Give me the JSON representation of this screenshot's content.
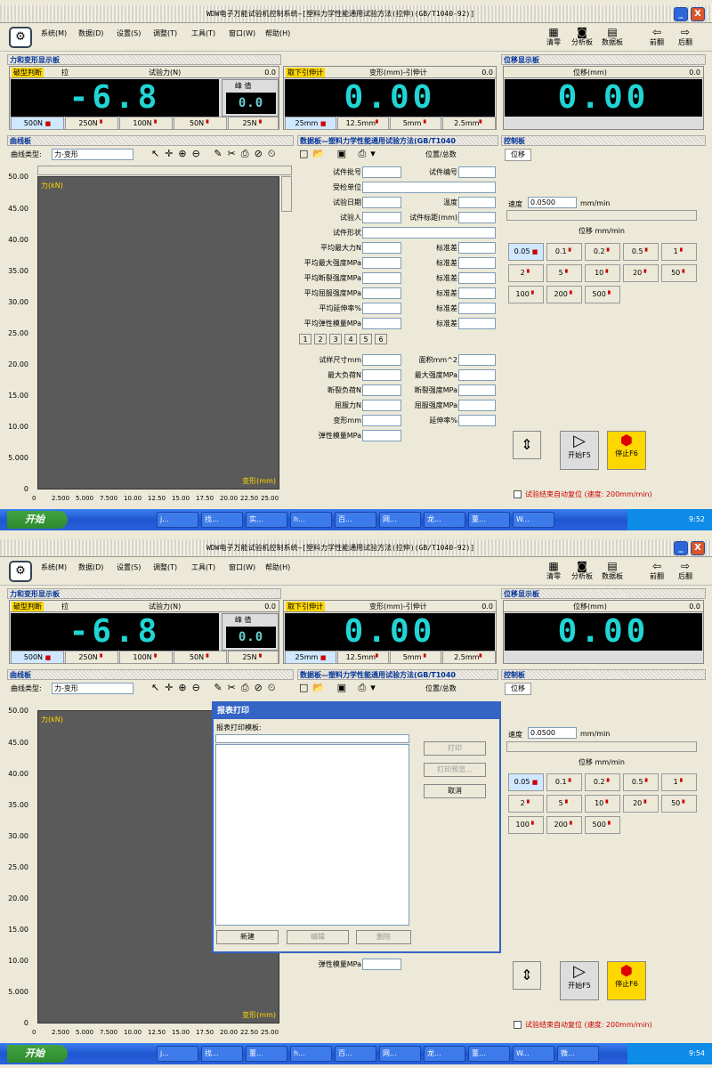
{
  "window": {
    "title": "WDW电子万能试验机控制系统—[塑料力学性能通用试验方法(拉伸)(GB/T1040-92)]",
    "minimize": "_",
    "close": "X"
  },
  "menu": [
    "系统(M)",
    "数据(D)",
    "设置(S)",
    "调整(T)",
    "工具(T)",
    "窗口(W)",
    "帮助(H)"
  ],
  "toolbar": {
    "clear": "清零",
    "analysis": "分析板",
    "data": "数据板",
    "prev": "前翻",
    "next": "后翻"
  },
  "panels": {
    "force_title": "力和变形显示板",
    "disp_title": "位移显示板",
    "curve_title": "曲线板",
    "data_title": "数据板—塑料力学性能通用试验方法(GB/T1040",
    "control_title": "控制板"
  },
  "force": {
    "mode": "破型判断",
    "tension": "拉",
    "label": "试验力(N)",
    "small_val": "0.0",
    "value": "-6.8",
    "peak_label": "峰 值",
    "peak_value": "0.0",
    "ranges": [
      "500N",
      "250N",
      "100N",
      "50N",
      "25N"
    ]
  },
  "deform": {
    "mode": "取下引伸计",
    "label": "变形(mm)-引伸计",
    "small_val": "0.0",
    "value": "0.00",
    "ranges": [
      "25mm",
      "12.5mm",
      "5mm",
      "2.5mm"
    ]
  },
  "disp": {
    "label": "位移(mm)",
    "small_val": "0.0",
    "value": "0.00"
  },
  "curve": {
    "type_label": "曲线类型:",
    "type_value": "力-变形",
    "yaxis": "力(kN)",
    "xaxis": "变形(mm)",
    "yticks": [
      "50.00",
      "45.00",
      "40.00",
      "35.00",
      "30.00",
      "25.00",
      "20.00",
      "15.00",
      "10.00",
      "5.000",
      "0"
    ],
    "xticks": [
      "0",
      "2.500",
      "5.000",
      "7.500",
      "10.00",
      "12.50",
      "15.00",
      "17.50",
      "20.00",
      "22.50",
      "25.00"
    ]
  },
  "datapanel": {
    "nav": "位置/总数",
    "fields": [
      {
        "l": "试件批号",
        "r": "试件编号"
      },
      {
        "l": "受检单位",
        "r": ""
      },
      {
        "l": "试验日期",
        "r": "温度"
      },
      {
        "l": "试验人",
        "r": "试件标距(mm)"
      },
      {
        "l": "试件形状",
        "r": ""
      },
      {
        "l": "平均最大力N",
        "r": "标准差"
      },
      {
        "l": "平均最大强度MPa",
        "r": "标准差"
      },
      {
        "l": "平均断裂强度MPa",
        "r": "标准差"
      },
      {
        "l": "平均屈服强度MPa",
        "r": "标准差"
      },
      {
        "l": "平均延伸率%",
        "r": "标准差"
      },
      {
        "l": "平均弹性模量MPa",
        "r": "标准差"
      }
    ],
    "tabs": [
      "1",
      "2",
      "3",
      "4",
      "5",
      "6"
    ],
    "fields2": [
      {
        "l": "试样尺寸mm",
        "r": "面积mm^2"
      },
      {
        "l": "最大负荷N",
        "r": "最大强度MPa"
      },
      {
        "l": "断裂负荷N",
        "r": "断裂强度MPa"
      },
      {
        "l": "屈服力N",
        "r": "屈服强度MPa"
      },
      {
        "l": "变形mm",
        "r": "延伸率%"
      },
      {
        "l": "弹性模量MPa",
        "r": ""
      }
    ]
  },
  "control": {
    "tab": "位移",
    "speed_label": "速度",
    "speed_value": "0.0500",
    "speed_unit": "mm/min",
    "group_label": "位移 mm/min",
    "buttons": [
      "0.05",
      "0.1",
      "0.2",
      "0.5",
      "1",
      "2",
      "5",
      "10",
      "20",
      "50",
      "100",
      "200",
      "500"
    ],
    "start": "开始F5",
    "stop": "停止F6",
    "auto_reset": "试验结束自动复位 (速度: 200mm/min)"
  },
  "taskbar": {
    "start": "开始",
    "tasks1": [
      "j...",
      "找...",
      "实...",
      "h...",
      "百...",
      "网...",
      "龙...",
      "董...",
      "W..."
    ],
    "time1": "9:52",
    "tasks2": [
      "j...",
      "找...",
      "董...",
      "h...",
      "百...",
      "网...",
      "龙...",
      "董...",
      "W...",
      "微..."
    ],
    "time2": "9:54"
  },
  "dialog": {
    "title": "报表打印",
    "template_label": "报表打印模板:",
    "print": "打印",
    "preview": "打印预览...",
    "cancel": "取消",
    "new": "新建",
    "edit": "编辑",
    "delete": "删除"
  }
}
